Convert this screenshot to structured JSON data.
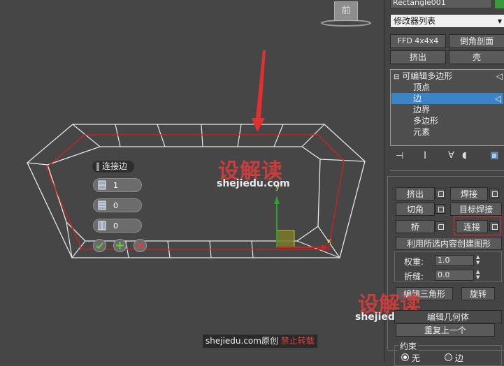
{
  "viewport": {
    "viewcube_label": "前",
    "caddy": {
      "title": "连接边",
      "segments": "1",
      "pinch": "0",
      "slide": "0"
    },
    "axis_y": "y",
    "axis_x": "x",
    "watermark_brand": "设解读",
    "watermark_url": "shejiedu.com",
    "footer_site": "shejiedu.com原创",
    "footer_warning": "禁止转载"
  },
  "panel": {
    "object_name": "Rectangle001",
    "object_color": "#3a9a3a",
    "modifier_list": "修改器列表",
    "mod_buttons": [
      "FFD 4x4x4",
      "倒角剖面",
      "挤出",
      "壳"
    ],
    "stack_root": "可编辑多边形",
    "stack_items": [
      "顶点",
      "边",
      "边界",
      "多边形",
      "元素"
    ],
    "stack_selected": "边",
    "edit_buttons": {
      "extrude": "挤出",
      "weld": "焊接",
      "chamfer": "切角",
      "target_weld": "目标焊接",
      "bridge": "桥",
      "connect": "连接",
      "create_shape": "利用所选内容创建图形"
    },
    "weight_label": "权重:",
    "weight_value": "1.0",
    "crease_label": "折缝:",
    "crease_value": "0.0",
    "edit_tri": "编辑三角形",
    "turn": "旋转",
    "edit_geometry": "编辑几何体",
    "repeat_last": "重复上一个",
    "constraints": "约束",
    "constraint_none": "无",
    "constraint_edge": "边"
  }
}
